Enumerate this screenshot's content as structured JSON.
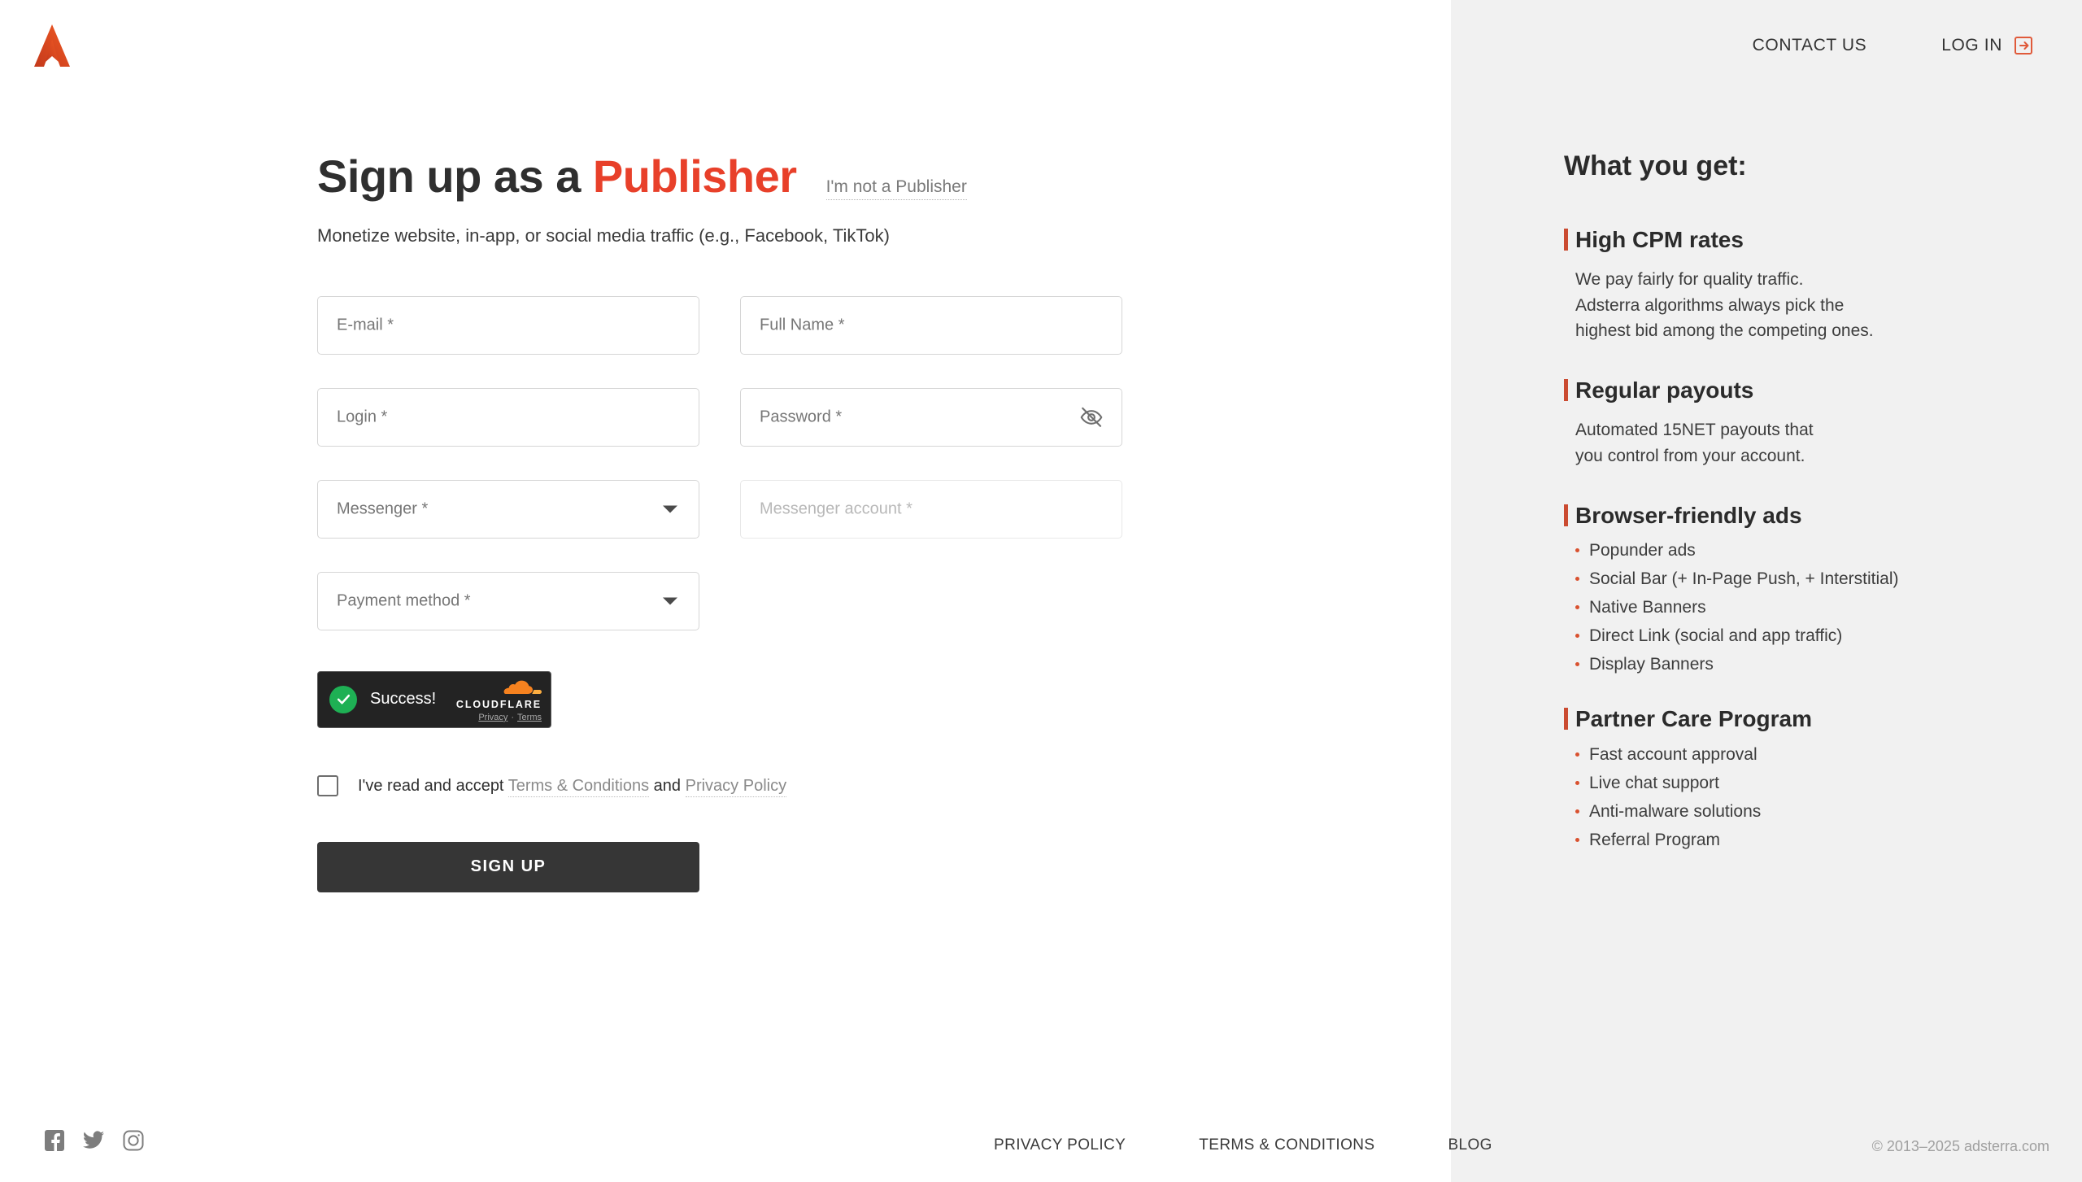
{
  "brand": {
    "logo_icon": "adsterra-a-logo-icon",
    "logo_color": "#e8451f"
  },
  "header": {
    "contact_label": "CONTACT US",
    "login_label": "LOG IN",
    "login_icon": "login-arrow-icon",
    "login_icon_color": "#e05a3a"
  },
  "form": {
    "title_prefix": "Sign up as a ",
    "title_accent": "Publisher",
    "title_accent_color": "#e8402a",
    "switch_role_label": "I'm not a Publisher",
    "subtitle": "Monetize website, in-app, or social media traffic (e.g., Facebook, TikTok)",
    "fields": {
      "email": {
        "label": "E-mail *",
        "value": ""
      },
      "full_name": {
        "label": "Full Name *",
        "value": ""
      },
      "login": {
        "label": "Login *",
        "value": ""
      },
      "password": {
        "label": "Password *",
        "value": "",
        "toggle_icon": "eye-off-icon"
      },
      "messenger": {
        "label": "Messenger *",
        "value": ""
      },
      "messenger_account": {
        "label": "Messenger account *",
        "value": ""
      },
      "payment_method": {
        "label": "Payment method *",
        "value": ""
      }
    },
    "captcha": {
      "status": "Success!",
      "status_icon": "check-circle-icon",
      "status_color": "#1eb054",
      "brand": "CLOUDFLARE",
      "brand_icon": "cloudflare-cloud-icon",
      "privacy_label": "Privacy",
      "separator": "·",
      "terms_label": "Terms"
    },
    "terms": {
      "prefix": "I've read and accept",
      "terms_link": "Terms & Conditions",
      "conjunction": "and",
      "privacy_link": "Privacy Policy",
      "checked": false
    },
    "submit_label": "SIGN UP"
  },
  "sidebar": {
    "background": "#f1f1f1",
    "accent_color": "#cb4b31",
    "title": "What you get:",
    "blocks": [
      {
        "heading": "High CPM rates",
        "body": "We pay fairly for quality traffic. Adsterra algorithms always pick the highest bid among the competing ones.",
        "body_lines": [
          "We pay fairly for quality traffic.",
          "Adsterra algorithms always pick the",
          "highest bid among the competing ones."
        ],
        "items": []
      },
      {
        "heading": "Regular payouts",
        "body": "Automated 15NET payouts that you control from your account.",
        "body_lines": [
          "Automated 15NET payouts that",
          "you control from your account."
        ],
        "items": []
      },
      {
        "heading": "Browser-friendly ads",
        "body": "",
        "body_lines": [],
        "items": [
          "Popunder ads",
          "Social Bar (+ In-Page Push, + Interstitial)",
          "Native Banners",
          "Direct Link (social and app traffic)",
          "Display Banners"
        ]
      },
      {
        "heading": "Partner Care Program",
        "body": "",
        "body_lines": [],
        "items": [
          "Fast account approval",
          "Live chat support",
          "Anti-malware solutions",
          "Referral Program"
        ]
      }
    ]
  },
  "footer": {
    "social": [
      {
        "name": "facebook-icon",
        "label": "Facebook"
      },
      {
        "name": "twitter-icon",
        "label": "Twitter"
      },
      {
        "name": "instagram-icon",
        "label": "Instagram"
      }
    ],
    "links": [
      "PRIVACY POLICY",
      "TERMS & CONDITIONS",
      "BLOG"
    ],
    "copyright": "© 2013–2025 adsterra.com"
  }
}
